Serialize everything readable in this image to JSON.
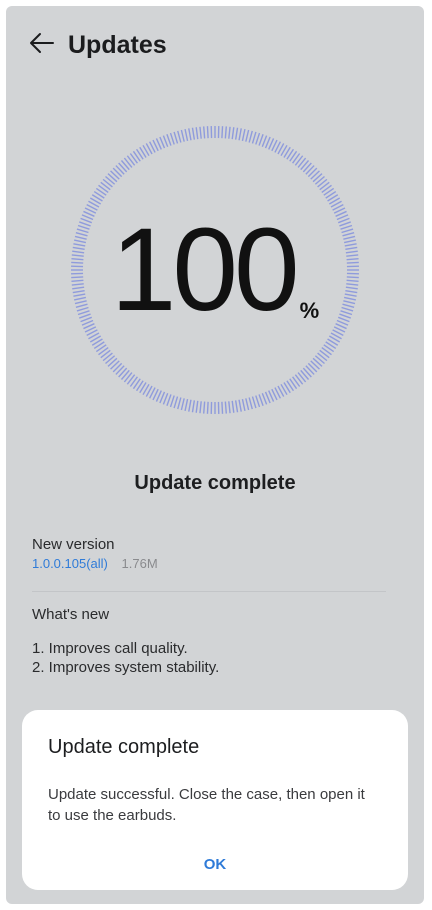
{
  "header": {
    "title": "Updates"
  },
  "progress": {
    "percent": 100,
    "value_text": "100",
    "unit": "%"
  },
  "status_text": "Update complete",
  "version": {
    "label": "New version",
    "value": "1.0.0.105(all)",
    "size": "1.76M"
  },
  "whats_new": {
    "label": "What's new",
    "items": [
      "1. Improves call quality.",
      "2. Improves system stability."
    ]
  },
  "dialog": {
    "title": "Update complete",
    "message": "Update successful. Close the case, then open it to use the earbuds.",
    "ok_label": "OK"
  },
  "colors": {
    "accent": "#2f7bd8",
    "ring": "#8f9bdc",
    "background": "#d2d4d6"
  }
}
